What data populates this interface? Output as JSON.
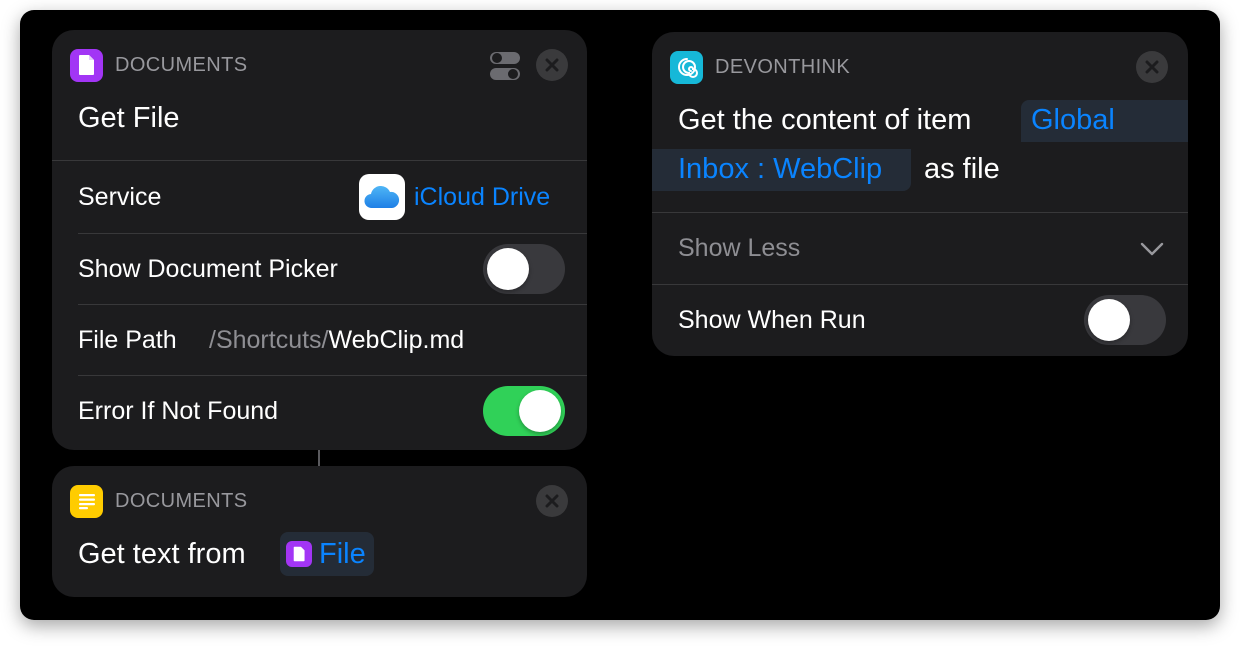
{
  "card_get_file": {
    "app_name": "DOCUMENTS",
    "title": "Get File",
    "service_label": "Service",
    "service_value": "iCloud Drive",
    "picker_label": "Show Document Picker",
    "picker_on": false,
    "filepath_label": "File Path",
    "filepath_prefix": "/Shortcuts/",
    "filepath_file": "WebClip.md",
    "error_label": "Error If Not Found",
    "error_on": true
  },
  "card_get_text": {
    "app_name": "DOCUMENTS",
    "title_prefix": "Get text from",
    "token": "File"
  },
  "card_devonthink": {
    "app_name": "DEVONTHINK",
    "title_prefix": "Get the content of item",
    "token_line1": "Global",
    "token_line2": "Inbox : WebClip",
    "title_suffix": "as file",
    "show_less_label": "Show Less",
    "show_when_run_label": "Show When Run",
    "show_when_run_on": false
  },
  "colors": {
    "accent": "#0a84ff",
    "toggle_on": "#30d158",
    "card_bg": "#1c1c1e",
    "documents_icon": "#a235f5",
    "text_icon": "#ffcc00",
    "devonthink_icon": "#16b8d8"
  },
  "icons": {
    "documents": "document-icon",
    "text": "text-lines-icon",
    "devonthink": "devonthink-icon",
    "icloud": "icloud-icon",
    "settings": "toggle-settings-icon",
    "close": "close-icon",
    "chevron": "chevron-down-icon"
  }
}
